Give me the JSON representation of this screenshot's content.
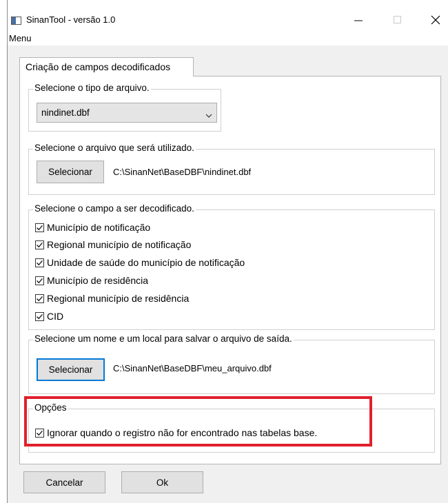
{
  "window": {
    "title": "SinanTool - versão 1.0",
    "menu_label": "Menu"
  },
  "tab": {
    "label": "Criação de campos decodificados"
  },
  "file_type": {
    "legend": "Selecione o tipo de arquivo.",
    "selected": "nindinet.dbf"
  },
  "input_file": {
    "legend": "Selecione o arquivo que será utilizado.",
    "button": "Selecionar",
    "path": "C:\\SinanNet\\BaseDBF\\nindinet.dbf"
  },
  "fields": {
    "legend": "Selecione o campo a ser decodificado.",
    "items": [
      {
        "label": "Município de notificação",
        "checked": true
      },
      {
        "label": "Regional município de notificação",
        "checked": true
      },
      {
        "label": "Unidade de saúde do município de notificação",
        "checked": true
      },
      {
        "label": "Município de residência",
        "checked": true
      },
      {
        "label": "Regional município de residência",
        "checked": true
      },
      {
        "label": "CID",
        "checked": true
      }
    ]
  },
  "output_file": {
    "legend": "Selecione um nome e um local para salvar o arquivo de saída.",
    "button": "Selecionar",
    "path": "C:\\SinanNet\\BaseDBF\\meu_arquivo.dbf"
  },
  "options": {
    "legend": "Opções",
    "ignore_label": "Ignorar quando o registro não for encontrado nas tabelas base.",
    "ignore_checked": true
  },
  "buttons": {
    "cancel": "Cancelar",
    "ok": "Ok"
  },
  "colors": {
    "highlight": "#e0202c",
    "focus": "#0078d7"
  }
}
